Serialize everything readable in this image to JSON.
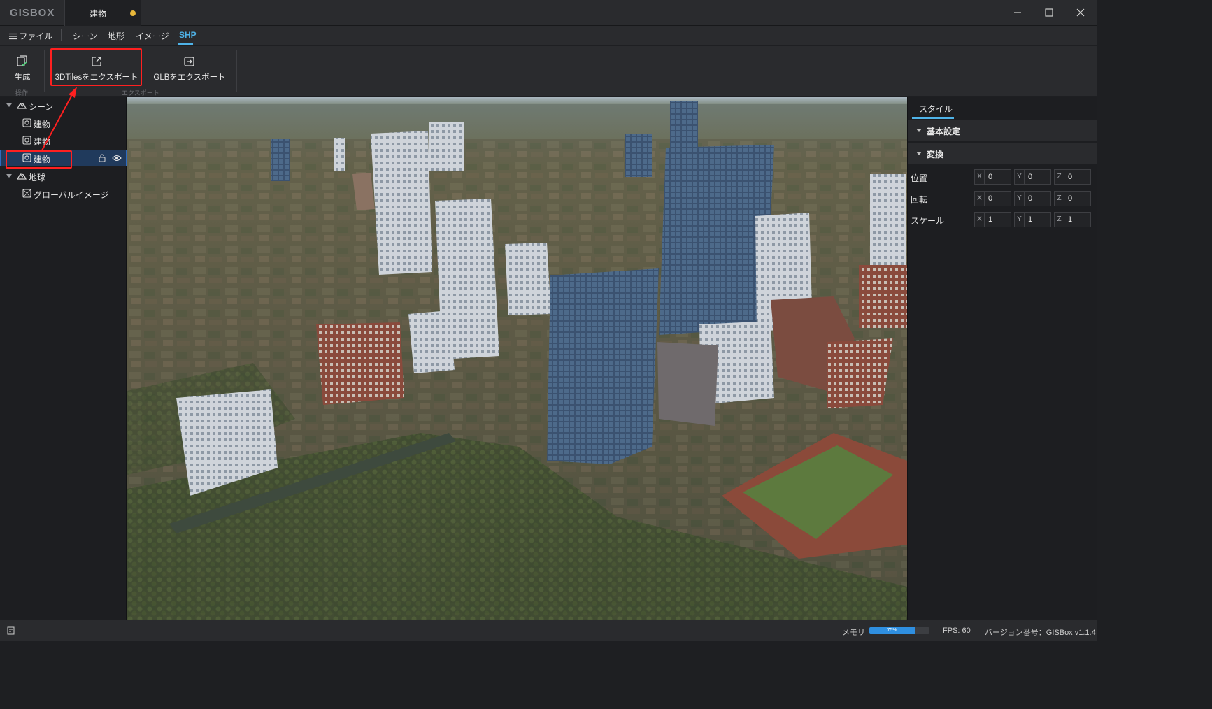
{
  "app": {
    "logo": "GISBOX"
  },
  "document_tab": {
    "title": "建物",
    "unsaved_color": "#e8b73a"
  },
  "menu": {
    "file": "ファイル",
    "items": [
      "シーン",
      "地形",
      "イメージ",
      "SHP"
    ],
    "active": "SHP"
  },
  "ribbon": {
    "generate_label": "生成",
    "operation_group": "操作",
    "export_3dtiles_label": "3DTilesをエクスポート",
    "export_glb_label": "GLBをエクスポート",
    "export_group": "エクスポート"
  },
  "tree": {
    "scene_label": "シーン",
    "buildings": [
      "建物",
      "建物",
      "建物"
    ],
    "earth_label": "地球",
    "imagery_label": "グローバルイメージ"
  },
  "properties": {
    "tab_label": "スタイル",
    "basic_section": "基本設定",
    "transform_section": "変換",
    "position": {
      "label": "位置",
      "x": "0",
      "y": "0",
      "z": "0"
    },
    "rotation": {
      "label": "回転",
      "x": "0",
      "y": "0",
      "z": "0"
    },
    "scale": {
      "label": "スケール",
      "x": "1",
      "y": "1",
      "z": "1"
    },
    "axes": {
      "x": "X",
      "y": "Y",
      "z": "Z"
    }
  },
  "status": {
    "memory_label": "メモリ",
    "memory_percent_text": "75%",
    "memory_fraction": 0.75,
    "fps": "FPS: 60",
    "version": "バージョン番号：GISBox v1.1.4"
  },
  "colors": {
    "accent": "#4fb3e8",
    "highlight": "#ff2020",
    "selection": "#2e6bbf"
  },
  "icons": [
    "layers-icon",
    "generate-icon",
    "export-link-icon",
    "export-glb-icon",
    "scene-icon",
    "model-icon",
    "lock-icon",
    "eye-icon",
    "globe-icon",
    "imagery-icon",
    "minimize-icon",
    "maximize-icon",
    "close-icon",
    "log-icon"
  ]
}
